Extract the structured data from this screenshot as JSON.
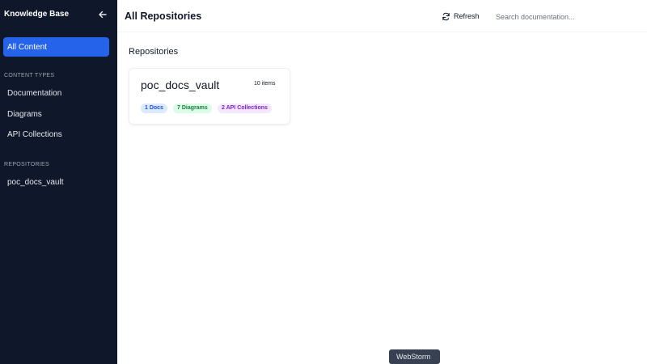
{
  "sidebar": {
    "title": "Knowledge Base",
    "collapse_icon": "arrow-left-icon",
    "active_item": "All Content",
    "content_types_header": "CONTENT TYPES",
    "content_types": [
      {
        "label": "Documentation"
      },
      {
        "label": "Diagrams"
      },
      {
        "label": "API Collections"
      }
    ],
    "repositories_header": "REPOSITORIES",
    "repositories": [
      {
        "label": "poc_docs_vault"
      }
    ]
  },
  "header": {
    "title": "All Repositories",
    "refresh_label": "Refresh",
    "refresh_icon": "refresh-icon",
    "search_placeholder": "Search documentation..."
  },
  "main": {
    "section_title": "Repositories",
    "cards": [
      {
        "name": "poc_docs_vault",
        "item_count": "10 items",
        "badges": {
          "docs": "1 Docs",
          "diagrams": "7 Diagrams",
          "api": "2 API Collections"
        }
      }
    ]
  },
  "tooltip": "WebStorm",
  "colors": {
    "sidebar_bg": "#0f172a",
    "accent": "#2563eb",
    "docs_badge": "#dbeafe",
    "diagrams_badge": "#dcfce7",
    "api_badge": "#f3e8ff"
  }
}
